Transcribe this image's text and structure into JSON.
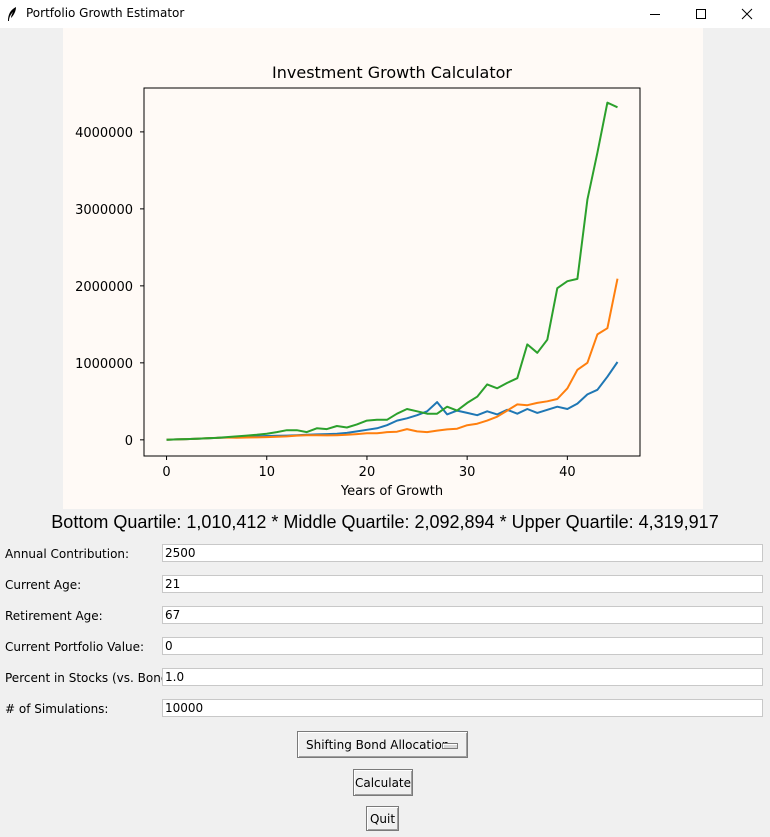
{
  "window": {
    "title": "Portfolio Growth Estimator",
    "icons": {
      "app": "feather-icon",
      "minimize": "minimize-icon",
      "maximize": "maximize-icon",
      "close": "close-icon"
    }
  },
  "chart_data": {
    "type": "line",
    "title": "Investment Growth Calculator",
    "xlabel": "Years of Growth",
    "ylabel": "",
    "xlim": [
      -2.25,
      47.25
    ],
    "ylim": [
      -210000,
      4570000
    ],
    "xticks": [
      0,
      10,
      20,
      30,
      40
    ],
    "yticks": [
      0,
      1000000,
      2000000,
      3000000,
      4000000
    ],
    "xtick_labels": [
      "0",
      "10",
      "20",
      "30",
      "40"
    ],
    "ytick_labels": [
      "0",
      "1000000",
      "2000000",
      "3000000",
      "4000000"
    ],
    "grid": false,
    "x": [
      0,
      1,
      2,
      3,
      4,
      5,
      6,
      7,
      8,
      9,
      10,
      11,
      12,
      13,
      14,
      15,
      16,
      17,
      18,
      19,
      20,
      21,
      22,
      23,
      24,
      25,
      26,
      27,
      28,
      29,
      30,
      31,
      32,
      33,
      34,
      35,
      36,
      37,
      38,
      39,
      40,
      41,
      42,
      43,
      44,
      45
    ],
    "series": [
      {
        "color": "#1f77b4",
        "values": [
          0,
          5000,
          10000,
          14000,
          19000,
          25000,
          30000,
          35000,
          40000,
          45000,
          50000,
          52000,
          55000,
          60000,
          65000,
          70000,
          75000,
          80000,
          90000,
          110000,
          130000,
          150000,
          190000,
          250000,
          280000,
          320000,
          370000,
          490000,
          330000,
          380000,
          350000,
          320000,
          370000,
          330000,
          390000,
          340000,
          400000,
          350000,
          390000,
          430000,
          400000,
          470000,
          590000,
          650000,
          820000,
          1010412
        ]
      },
      {
        "color": "#ff7f0e",
        "values": [
          0,
          5000,
          10000,
          15000,
          20000,
          25000,
          30000,
          28000,
          30000,
          32000,
          35000,
          40000,
          45000,
          55000,
          60000,
          60000,
          58000,
          60000,
          65000,
          75000,
          85000,
          85000,
          100000,
          105000,
          140000,
          110000,
          100000,
          120000,
          135000,
          145000,
          190000,
          210000,
          250000,
          300000,
          380000,
          460000,
          450000,
          480000,
          500000,
          530000,
          670000,
          910000,
          1000000,
          1370000,
          1450000,
          2092894
        ]
      },
      {
        "color": "#2ca02c",
        "values": [
          0,
          5000,
          10000,
          15000,
          20000,
          25000,
          35000,
          45000,
          55000,
          65000,
          80000,
          100000,
          125000,
          125000,
          100000,
          150000,
          140000,
          180000,
          160000,
          200000,
          250000,
          260000,
          260000,
          340000,
          400000,
          370000,
          340000,
          340000,
          430000,
          380000,
          480000,
          560000,
          720000,
          670000,
          740000,
          800000,
          1240000,
          1130000,
          1300000,
          1970000,
          2060000,
          2090000,
          3120000,
          3730000,
          4380000,
          4319917
        ]
      }
    ]
  },
  "summary_text": "Bottom Quartile: 1,010,412 * Middle Quartile: 2,092,894 * Upper Quartile: 4,319,917",
  "form": {
    "fields": [
      {
        "label": "Annual Contribution:",
        "value": "2500"
      },
      {
        "label": "Current Age:",
        "value": "21"
      },
      {
        "label": "Retirement Age:",
        "value": "67"
      },
      {
        "label": "Current Portfolio Value:",
        "value": "0"
      },
      {
        "label": "Percent in Stocks (vs. Bonds):",
        "value": "1.0"
      },
      {
        "label": "# of Simulations:",
        "value": "10000"
      }
    ]
  },
  "allocation_menu": {
    "selected": "Shifting Bond Allocation"
  },
  "buttons": {
    "calculate": "Calculate",
    "quit": "Quit"
  }
}
